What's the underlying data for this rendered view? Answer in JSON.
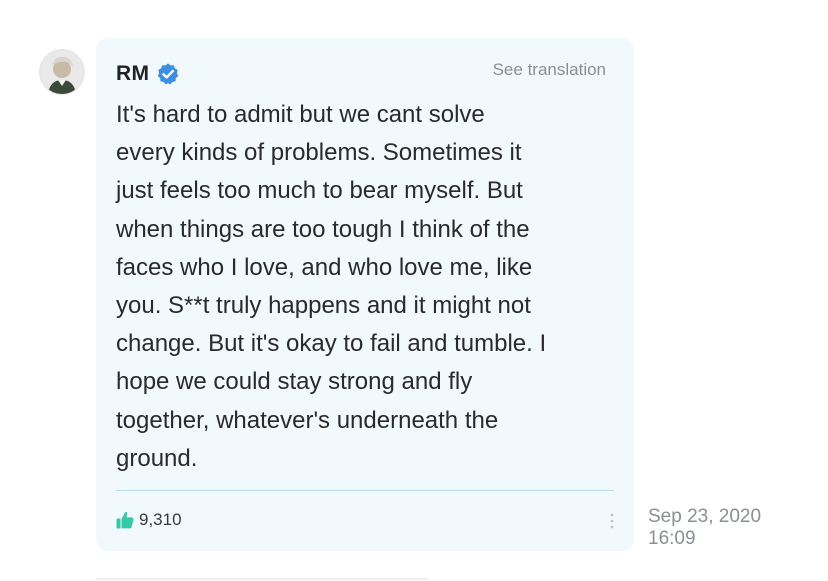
{
  "author": {
    "name": "RM",
    "verified_icon": "verified-badge-icon",
    "avatar_icon": "avatar-image"
  },
  "actions": {
    "translate_label": "See translation",
    "more_icon": "more-vertical-icon",
    "like_icon": "thumbs-up-icon"
  },
  "message": {
    "text": "It's hard to admit but we cant solve\nevery kinds of problems. Sometimes it\njust feels too much to bear myself. But\nwhen things are too tough I think of the\nfaces who I love, and who love me, like\nyou. S**t truly happens and it might not\nchange. But it's okay to fail and tumble. I\nhope we could stay strong and fly\ntogether, whatever's underneath the\nground."
  },
  "stats": {
    "likes": "9,310"
  },
  "timestamp": {
    "date": "Sep 23, 2020",
    "time": "16:09"
  },
  "colors": {
    "bubble_background": "#f1f9fd",
    "verified_blue": "#3d8fe0",
    "like_green": "#35c9a5",
    "secondary_text": "#8a8f94",
    "divider": "#b9dce6"
  }
}
